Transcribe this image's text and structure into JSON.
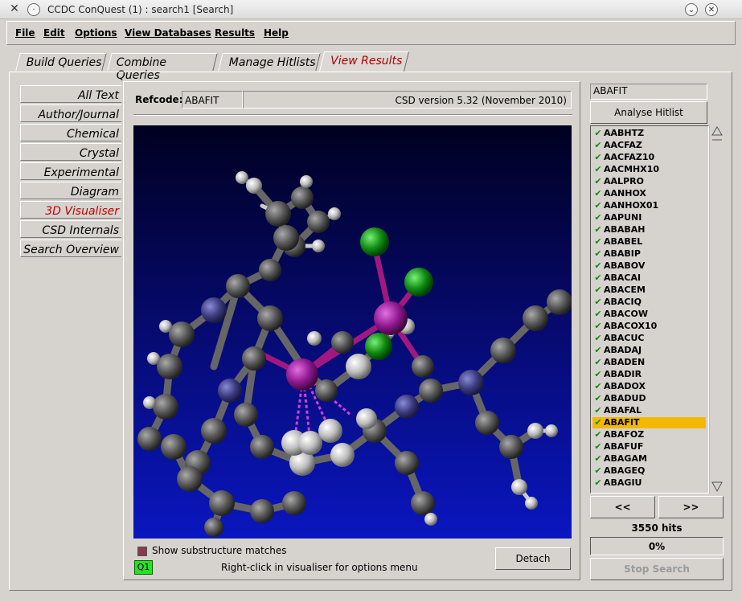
{
  "window": {
    "title": "CCDC ConQuest (1) : search1 [Search]"
  },
  "menu": [
    "File",
    "Edit",
    "Options",
    "View Databases",
    "Results",
    "Help"
  ],
  "tabs": [
    {
      "label": "Build Queries"
    },
    {
      "label": "Combine Queries"
    },
    {
      "label": "Manage Hitlists"
    },
    {
      "label": "View Results",
      "active": true
    }
  ],
  "nav": [
    {
      "label": "All Text"
    },
    {
      "label": "Author/Journal"
    },
    {
      "label": "Chemical"
    },
    {
      "label": "Crystal"
    },
    {
      "label": "Experimental"
    },
    {
      "label": "Diagram"
    },
    {
      "label": "3D Visualiser",
      "active": true
    },
    {
      "label": "CSD Internals"
    },
    {
      "label": "Search Overview"
    }
  ],
  "refcode": {
    "label": "Refcode:",
    "value": "ABAFIT"
  },
  "csd_version": "CSD version 5.32 (November 2010)",
  "visualiser": {
    "show_substructure_label": "Show substructure matches",
    "query_badge": "Q1",
    "hint": "Right-click in visualiser for options menu",
    "detach_label": "Detach"
  },
  "right": {
    "search_value": "ABAFIT",
    "analyse_label": "Analyse Hitlist",
    "hits": [
      "AABHTZ",
      "AACFAZ",
      "AACFAZ10",
      "AACMHX10",
      "AALPRO",
      "AANHOX",
      "AANHOX01",
      "AAPUNI",
      "ABABAH",
      "ABABEL",
      "ABABIP",
      "ABABOV",
      "ABACAI",
      "ABACEM",
      "ABACIQ",
      "ABACOW",
      "ABACOX10",
      "ABACUC",
      "ABADAJ",
      "ABADEN",
      "ABADIR",
      "ABADOX",
      "ABADUD",
      "ABAFAL",
      "ABAFIT",
      "ABAFOZ",
      "ABAFUF",
      "ABAGAM",
      "ABAGEQ",
      "ABAGIU"
    ],
    "selected": "ABAFIT",
    "prev_label": "<<",
    "next_label": ">>",
    "hits_count": "3550 hits",
    "progress_text": "0%",
    "progress_value": 0,
    "stop_label": "Stop Search"
  },
  "colors": {
    "active_tab": "#b00000",
    "selected_hit": "#f4b800",
    "check": "#148a14",
    "query_badge": "#28e028"
  },
  "icons": {
    "app": "tools-icon",
    "menu": "window-menu-icon",
    "chevron": "chevron-down-icon",
    "close": "close-icon",
    "check": "check-icon"
  }
}
